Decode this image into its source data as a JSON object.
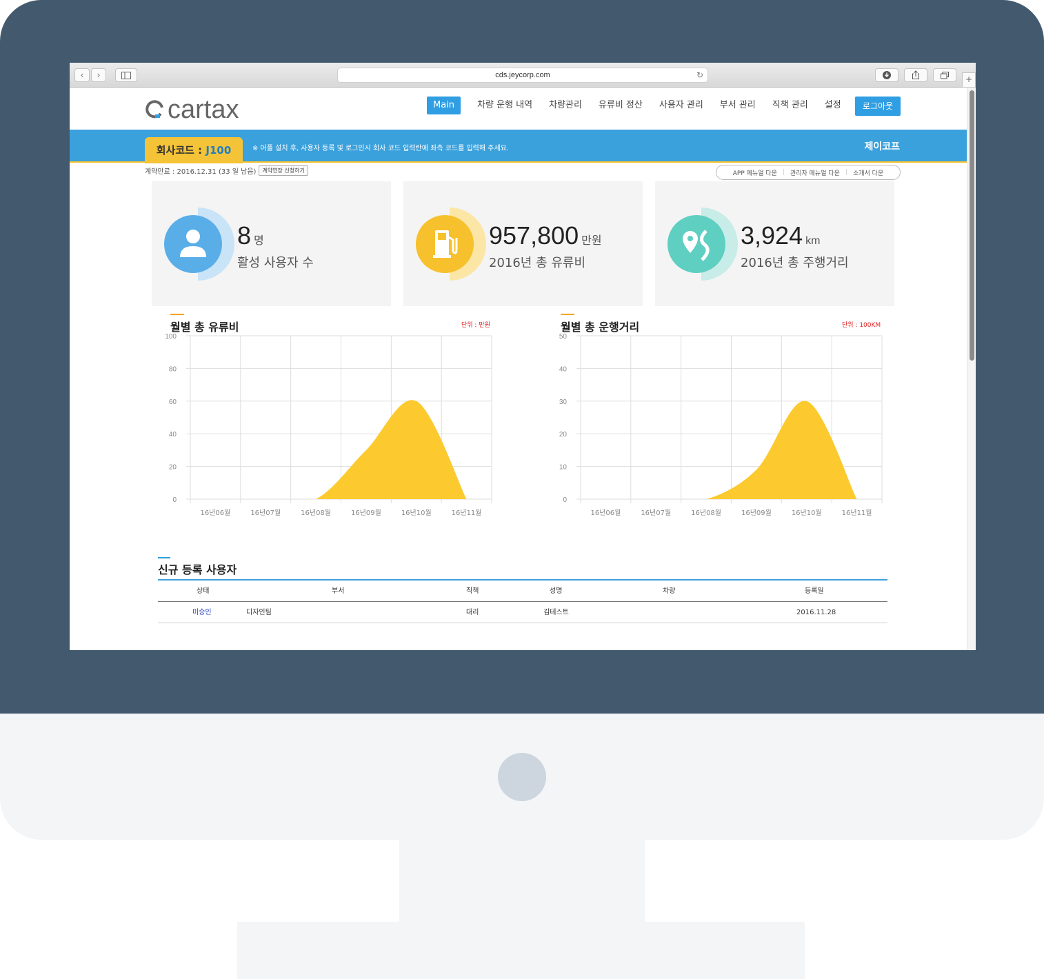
{
  "browser": {
    "url": "cds.jeycorp.com",
    "back_glyph": "‹",
    "forward_glyph": "›",
    "new_tab_glyph": "+"
  },
  "app": {
    "logo_text": "cartax",
    "nav": [
      "Main",
      "차량 운행 내역",
      "차량관리",
      "유류비 정산",
      "사용자 관리",
      "부서 관리",
      "직책 관리",
      "설정"
    ],
    "logout_label": "로그아웃"
  },
  "banner": {
    "code_label": "회사코드 : ",
    "code_value": "J100",
    "note": "※ 어플 설치 후, 사용자 등록 및 로그인시 회사 코드 입력란에 좌측 코드를 입력해 주세요.",
    "company": "제이코프"
  },
  "contract": {
    "text": "계약만료 : 2016.12.31 (33 일 남음)",
    "renew_button": "계약연장 신청하기"
  },
  "downloads": [
    "APP 메뉴얼 다운",
    "관리자 메뉴얼 다운",
    "소개서 다운"
  ],
  "stats": [
    {
      "value": "8",
      "unit": "명",
      "label": "활성 사용자 수",
      "color": "#5aaee8",
      "icon": "user-icon"
    },
    {
      "value": "957,800",
      "unit": "만원",
      "label": "2016년 총 유류비",
      "color": "#f7c12d",
      "icon": "fuel-pump-icon"
    },
    {
      "value": "3,924",
      "unit": "km",
      "label": "2016년 총 주행거리",
      "color": "#5fcfc2",
      "icon": "route-pin-icon"
    }
  ],
  "chart_data": [
    {
      "type": "area",
      "title": "월별 총 유류비",
      "unit_label": "단위 : 만원",
      "categories": [
        "16년06월",
        "16년07월",
        "16년08월",
        "16년09월",
        "16년10월",
        "16년11월"
      ],
      "values": [
        0,
        0,
        0,
        30,
        60,
        0
      ],
      "ylim": [
        0,
        100
      ],
      "yticks": [
        0,
        20,
        40,
        60,
        80,
        100
      ],
      "grid": true,
      "color": "#fcca2e"
    },
    {
      "type": "area",
      "title": "월별 총 운행거리",
      "unit_label": "단위 : 100KM",
      "categories": [
        "16년06월",
        "16년07월",
        "16년08월",
        "16년09월",
        "16년10월",
        "16년11월"
      ],
      "values": [
        0,
        0,
        0,
        9,
        30,
        0
      ],
      "ylim": [
        0,
        50
      ],
      "yticks": [
        0,
        10,
        20,
        30,
        40,
        50
      ],
      "grid": true,
      "color": "#fcca2e"
    }
  ],
  "new_users": {
    "title": "신규 등록 사용자",
    "headers": [
      "상태",
      "부서",
      "직책",
      "성명",
      "차량",
      "등록일"
    ],
    "rows": [
      {
        "status": "미승인",
        "dept": "디자인팀",
        "position": "대리",
        "name": "김테스트",
        "car": "",
        "date": "2016.11.28"
      }
    ]
  }
}
